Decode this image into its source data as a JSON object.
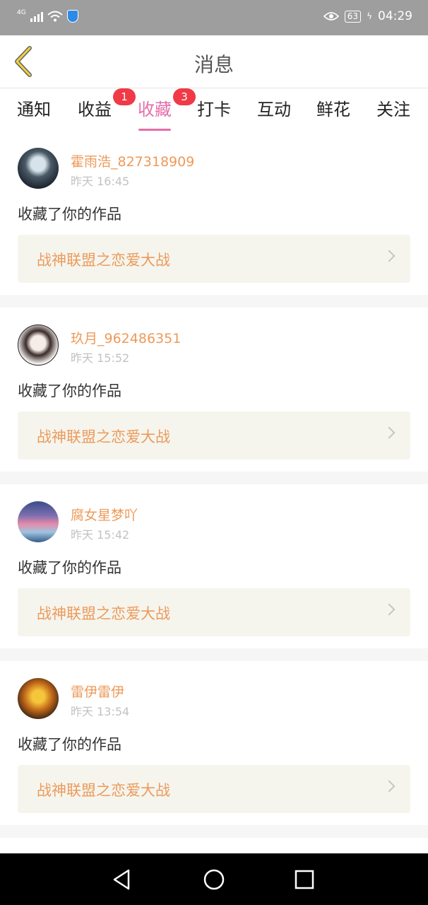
{
  "status_bar": {
    "network": "4G",
    "battery": "63",
    "time": "04:29"
  },
  "header": {
    "title": "消息"
  },
  "tabs": [
    {
      "label": "通知",
      "badge": null
    },
    {
      "label": "收益",
      "badge": "1"
    },
    {
      "label": "收藏",
      "badge": "3",
      "active": true
    },
    {
      "label": "打卡",
      "badge": null
    },
    {
      "label": "互动",
      "badge": null
    },
    {
      "label": "鲜花",
      "badge": null
    },
    {
      "label": "关注",
      "badge": null
    }
  ],
  "messages": [
    {
      "username": "霍雨浩_827318909",
      "time": "昨天 16:45",
      "action": "收藏了你的作品",
      "work_title": "战神联盟之恋爱大战"
    },
    {
      "username": "玖月_962486351",
      "time": "昨天 15:52",
      "action": "收藏了你的作品",
      "work_title": "战神联盟之恋爱大战"
    },
    {
      "username": "腐女星梦吖",
      "time": "昨天 15:42",
      "action": "收藏了你的作品",
      "work_title": "战神联盟之恋爱大战"
    },
    {
      "username": "雷伊雷伊",
      "time": "昨天 13:54",
      "action": "收藏了你的作品",
      "work_title": "战神联盟之恋爱大战"
    }
  ],
  "colors": {
    "accent": "#e46ea9",
    "username": "#ed9a5a",
    "badge": "#f03a47",
    "back_arrow": "#f2d23c"
  },
  "icons": {
    "back": "chevron-left-icon",
    "nav_back": "triangle-back-icon",
    "nav_home": "circle-home-icon",
    "nav_recent": "square-recent-icon"
  }
}
